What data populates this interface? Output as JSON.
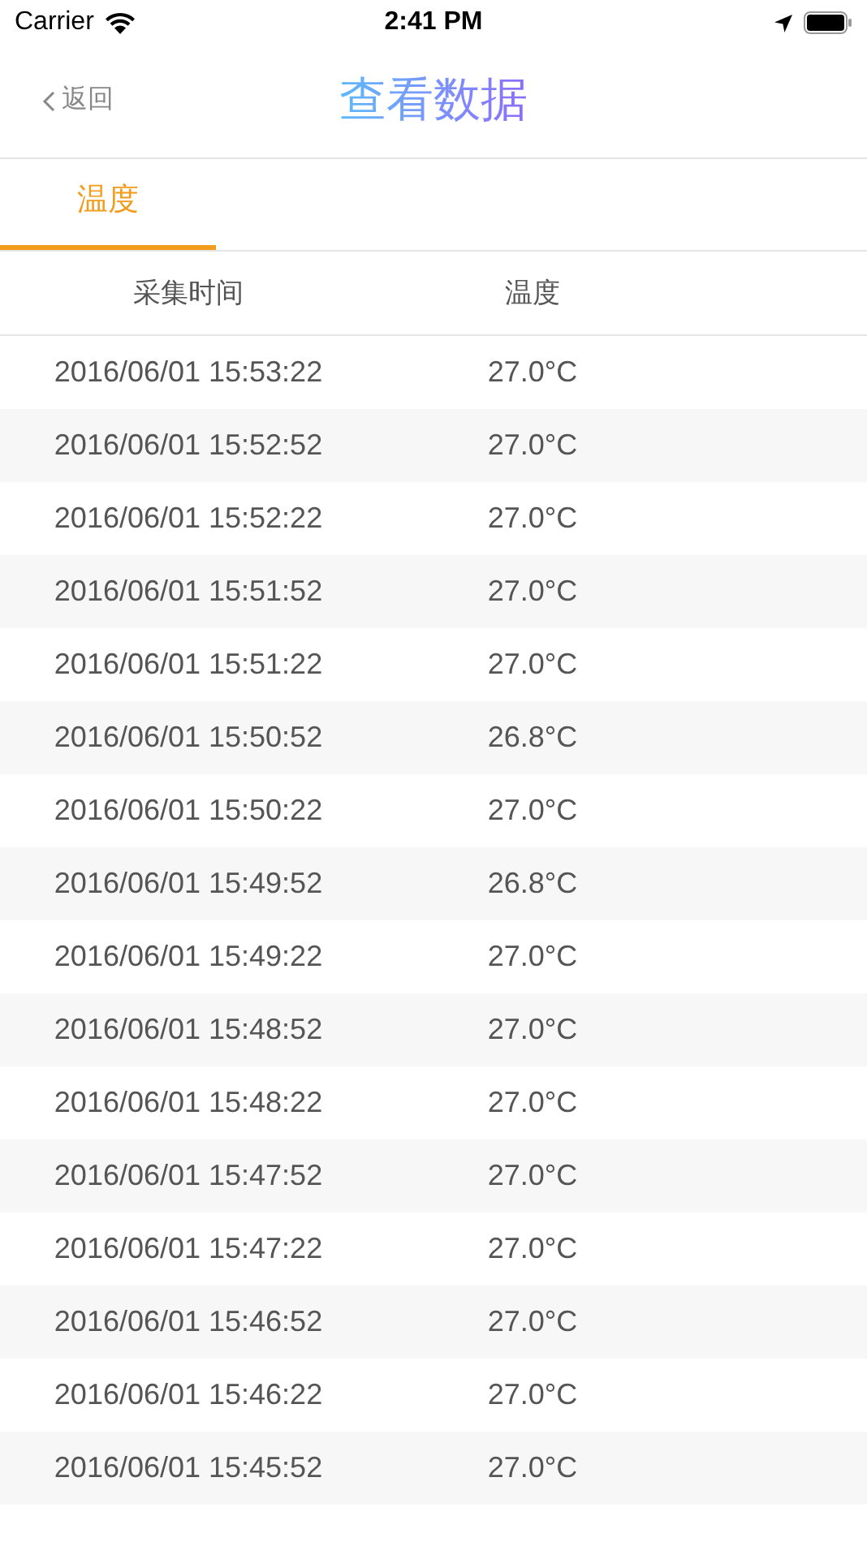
{
  "status_bar": {
    "carrier": "Carrier",
    "time": "2:41 PM"
  },
  "nav": {
    "back": "返回",
    "title": "查看数据"
  },
  "tabs": [
    {
      "label": "温度",
      "selected": true
    }
  ],
  "table": {
    "columns": [
      "采集时间",
      "温度"
    ],
    "rows": [
      {
        "time": "2016/06/01 15:53:22",
        "value": "27.0°C"
      },
      {
        "time": "2016/06/01 15:52:52",
        "value": "27.0°C"
      },
      {
        "time": "2016/06/01 15:52:22",
        "value": "27.0°C"
      },
      {
        "time": "2016/06/01 15:51:52",
        "value": "27.0°C"
      },
      {
        "time": "2016/06/01 15:51:22",
        "value": "27.0°C"
      },
      {
        "time": "2016/06/01 15:50:52",
        "value": "26.8°C"
      },
      {
        "time": "2016/06/01 15:50:22",
        "value": "27.0°C"
      },
      {
        "time": "2016/06/01 15:49:52",
        "value": "26.8°C"
      },
      {
        "time": "2016/06/01 15:49:22",
        "value": "27.0°C"
      },
      {
        "time": "2016/06/01 15:48:52",
        "value": "27.0°C"
      },
      {
        "time": "2016/06/01 15:48:22",
        "value": "27.0°C"
      },
      {
        "time": "2016/06/01 15:47:52",
        "value": "27.0°C"
      },
      {
        "time": "2016/06/01 15:47:22",
        "value": "27.0°C"
      },
      {
        "time": "2016/06/01 15:46:52",
        "value": "27.0°C"
      },
      {
        "time": "2016/06/01 15:46:22",
        "value": "27.0°C"
      },
      {
        "time": "2016/06/01 15:45:52",
        "value": "27.0°C"
      }
    ]
  }
}
